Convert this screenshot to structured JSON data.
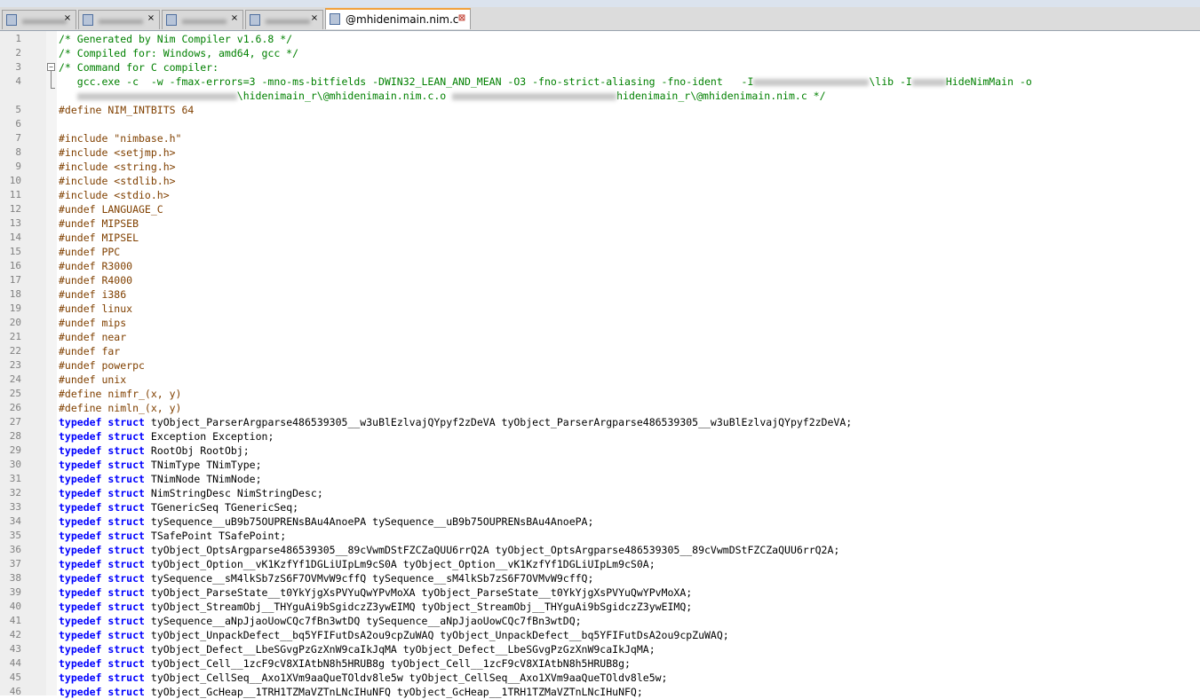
{
  "tabs": [
    {
      "label": "",
      "active": false
    },
    {
      "label": "",
      "active": false
    },
    {
      "label": "",
      "active": false
    },
    {
      "label": "",
      "active": false
    },
    {
      "label": "@mhidenimain.nim.c",
      "active": true
    }
  ],
  "icons": {
    "file": "file-icon",
    "close": "close-icon"
  },
  "colors": {
    "comment": "#008000",
    "preprocessor": "#804000",
    "keyword": "#0000ff",
    "type": "#8000ff",
    "tab_accent": "#f2a13b"
  },
  "lines": [
    {
      "n": "1",
      "t": "/* Generated by Nim Compiler v1.6.8 */"
    },
    {
      "n": "2",
      "t": "/* Compiled for: Windows, amd64, gcc */"
    },
    {
      "n": "3",
      "t": "/* Command for C compiler:"
    },
    {
      "n": "4",
      "a": "   gcc.exe -c  -w -fmax-errors=3 -mno-ms-bitfields -DWIN32_LEAN_AND_MEAN -O3 -fno-strict-aliasing -fno-ident   -I",
      "b": "\\lib -I",
      "c": "HideNimMain -o"
    },
    {
      "n": "",
      "b": "\\hidenimain_r\\@mhidenimain.nim.c.o ",
      "c": "hidenimain_r\\@mhidenimain.nim.c */"
    },
    {
      "n": "5",
      "t": "#define NIM_INTBITS 64"
    },
    {
      "n": "6",
      "t": ""
    },
    {
      "n": "7",
      "t": "#include \"nimbase.h\""
    },
    {
      "n": "8",
      "t": "#include <setjmp.h>"
    },
    {
      "n": "9",
      "t": "#include <string.h>"
    },
    {
      "n": "10",
      "t": "#include <stdlib.h>"
    },
    {
      "n": "11",
      "t": "#include <stdio.h>"
    },
    {
      "n": "12",
      "t": "#undef LANGUAGE_C"
    },
    {
      "n": "13",
      "t": "#undef MIPSEB"
    },
    {
      "n": "14",
      "t": "#undef MIPSEL"
    },
    {
      "n": "15",
      "t": "#undef PPC"
    },
    {
      "n": "16",
      "t": "#undef R3000"
    },
    {
      "n": "17",
      "t": "#undef R4000"
    },
    {
      "n": "18",
      "t": "#undef i386"
    },
    {
      "n": "19",
      "t": "#undef linux"
    },
    {
      "n": "20",
      "t": "#undef mips"
    },
    {
      "n": "21",
      "t": "#undef near"
    },
    {
      "n": "22",
      "t": "#undef far"
    },
    {
      "n": "23",
      "t": "#undef powerpc"
    },
    {
      "n": "24",
      "t": "#undef unix"
    },
    {
      "n": "25",
      "t": "#define nimfr_(x, y)"
    },
    {
      "n": "26",
      "t": "#define nimln_(x, y)"
    },
    {
      "n": "27",
      "k": "typedef",
      "s": "struct",
      "t": "tyObject_ParserArgparse486539305__w3uBlEzlvajQYpyf2zDeVA tyObject_ParserArgparse486539305__w3uBlEzlvajQYpyf2zDeVA;"
    },
    {
      "n": "28",
      "k": "typedef",
      "s": "struct",
      "t": "Exception Exception;"
    },
    {
      "n": "29",
      "k": "typedef",
      "s": "struct",
      "t": "RootObj RootObj;"
    },
    {
      "n": "30",
      "k": "typedef",
      "s": "struct",
      "t": "TNimType TNimType;"
    },
    {
      "n": "31",
      "k": "typedef",
      "s": "struct",
      "t": "TNimNode TNimNode;"
    },
    {
      "n": "32",
      "k": "typedef",
      "s": "struct",
      "t": "NimStringDesc NimStringDesc;"
    },
    {
      "n": "33",
      "k": "typedef",
      "s": "struct",
      "t": "TGenericSeq TGenericSeq;"
    },
    {
      "n": "34",
      "k": "typedef",
      "s": "struct",
      "t": "tySequence__uB9b75OUPRENsBAu4AnoePA tySequence__uB9b75OUPRENsBAu4AnoePA;"
    },
    {
      "n": "35",
      "k": "typedef",
      "s": "struct",
      "t": "TSafePoint TSafePoint;"
    },
    {
      "n": "36",
      "k": "typedef",
      "s": "struct",
      "t": "tyObject_OptsArgparse486539305__89cVwmDStFZCZaQUU6rrQ2A tyObject_OptsArgparse486539305__89cVwmDStFZCZaQUU6rrQ2A;"
    },
    {
      "n": "37",
      "k": "typedef",
      "s": "struct",
      "t": "tyObject_Option__vK1KzfYf1DGLiUIpLm9cS0A tyObject_Option__vK1KzfYf1DGLiUIpLm9cS0A;"
    },
    {
      "n": "38",
      "k": "typedef",
      "s": "struct",
      "t": "tySequence__sM4lkSb7zS6F7OVMvW9cffQ tySequence__sM4lkSb7zS6F7OVMvW9cffQ;"
    },
    {
      "n": "39",
      "k": "typedef",
      "s": "struct",
      "t": "tyObject_ParseState__t0YkYjgXsPVYuQwYPvMoXA tyObject_ParseState__t0YkYjgXsPVYuQwYPvMoXA;"
    },
    {
      "n": "40",
      "k": "typedef",
      "s": "struct",
      "t": "tyObject_StreamObj__THYguAi9bSgidczZ3ywEIMQ tyObject_StreamObj__THYguAi9bSgidczZ3ywEIMQ;"
    },
    {
      "n": "41",
      "k": "typedef",
      "s": "struct",
      "t": "tySequence__aNpJjaoUowCQc7fBn3wtDQ tySequence__aNpJjaoUowCQc7fBn3wtDQ;"
    },
    {
      "n": "42",
      "k": "typedef",
      "s": "struct",
      "t": "tyObject_UnpackDefect__bq5YFIFutDsA2ou9cpZuWAQ tyObject_UnpackDefect__bq5YFIFutDsA2ou9cpZuWAQ;"
    },
    {
      "n": "43",
      "k": "typedef",
      "s": "struct",
      "t": "tyObject_Defect__LbeSGvgPzGzXnW9caIkJqMA tyObject_Defect__LbeSGvgPzGzXnW9caIkJqMA;"
    },
    {
      "n": "44",
      "k": "typedef",
      "s": "struct",
      "t": "tyObject_Cell__1zcF9cV8XIAtbN8h5HRUB8g tyObject_Cell__1zcF9cV8XIAtbN8h5HRUB8g;"
    },
    {
      "n": "45",
      "k": "typedef",
      "s": "struct",
      "t": "tyObject_CellSeq__Axo1XVm9aaQueTOldv8le5w tyObject_CellSeq__Axo1XVm9aaQueTOldv8le5w;"
    },
    {
      "n": "46",
      "k": "typedef",
      "s": "struct",
      "t": "tyObject_GcHeap__1TRH1TZMaVZTnLNcIHuNFQ tyObject_GcHeap__1TRH1TZMaVZTnLNcIHuNFQ;"
    }
  ]
}
